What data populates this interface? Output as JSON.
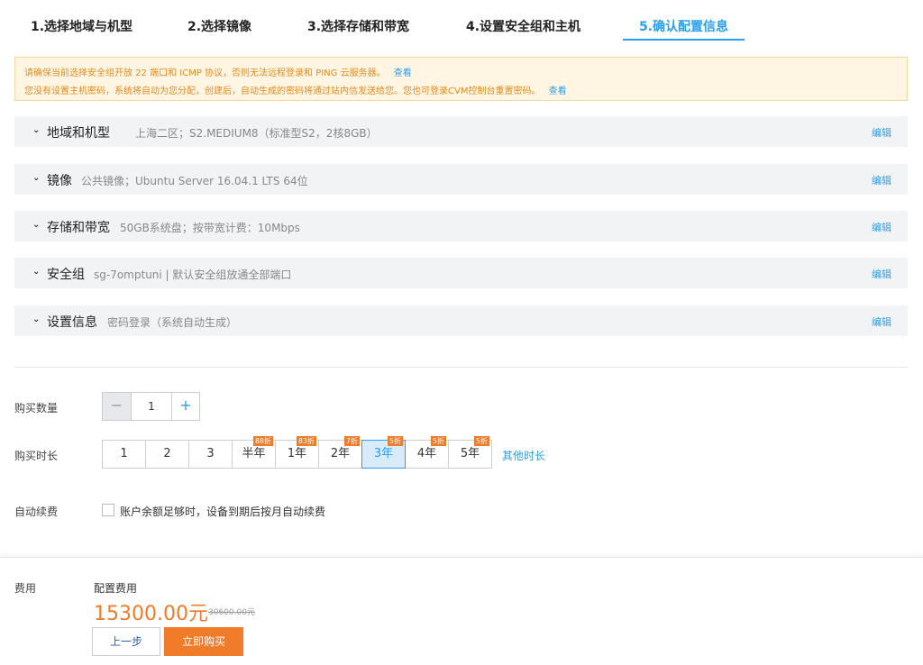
{
  "steps": [
    {
      "label": "1.选择地域与机型"
    },
    {
      "label": "2.选择镜像"
    },
    {
      "label": "3.选择存储和带宽"
    },
    {
      "label": "4.设置安全组和主机"
    },
    {
      "label": "5.确认配置信息"
    }
  ],
  "notice": {
    "line1": "请确保当前选择安全组开放 22 端口和 ICMP 协议，否则无法远程登录和 PING 云服务器。",
    "line1_link": "查看",
    "line2": "您没有设置主机密码，系统将自动为您分配，创建后，自动生成的密码将通过站内信发送给您。您也可登录CVM控制台重置密码。",
    "line2_link": "查看"
  },
  "summary": [
    {
      "title": "地域和机型",
      "desc": "上海二区；S2.MEDIUM8（标准型S2，2核8GB）",
      "edit": "编辑"
    },
    {
      "title": "镜像",
      "desc": "公共镜像；Ubuntu Server 16.04.1 LTS 64位",
      "edit": "编辑"
    },
    {
      "title": "存储和带宽",
      "desc": "50GB系统盘；按带宽计费：10Mbps",
      "edit": "编辑"
    },
    {
      "title": "安全组",
      "desc": "sg-7omptuni | 默认安全组放通全部端口",
      "edit": "编辑"
    },
    {
      "title": "设置信息",
      "desc": "密码登录（系统自动生成）",
      "edit": "编辑"
    }
  ],
  "quantity": {
    "label": "购买数量",
    "minus": "−",
    "value": "1",
    "plus": "+"
  },
  "duration": {
    "label": "购买时长",
    "options": [
      {
        "label": "1",
        "discount": ""
      },
      {
        "label": "2",
        "discount": ""
      },
      {
        "label": "3",
        "discount": ""
      },
      {
        "label": "半年",
        "discount": "88折"
      },
      {
        "label": "1年",
        "discount": "83折"
      },
      {
        "label": "2年",
        "discount": "7折"
      },
      {
        "label": "3年",
        "discount": "5折"
      },
      {
        "label": "4年",
        "discount": "5折"
      },
      {
        "label": "5年",
        "discount": "5折"
      }
    ],
    "selected": "3年",
    "more": "其他时长"
  },
  "auto_renew": {
    "label": "自动续费",
    "checkbox_text": "账户余额足够时，设备到期后按月自动续费"
  },
  "fee": {
    "label": "费用",
    "config_label": "配置费用",
    "price": "15300.00元",
    "original_price": "30600.00元"
  },
  "buttons": {
    "prev": "上一步",
    "buy": "立即购买"
  },
  "colors": {
    "accent": "#2a9ef0",
    "price": "#f07c2a",
    "warning_bg": "#fff5e3"
  }
}
